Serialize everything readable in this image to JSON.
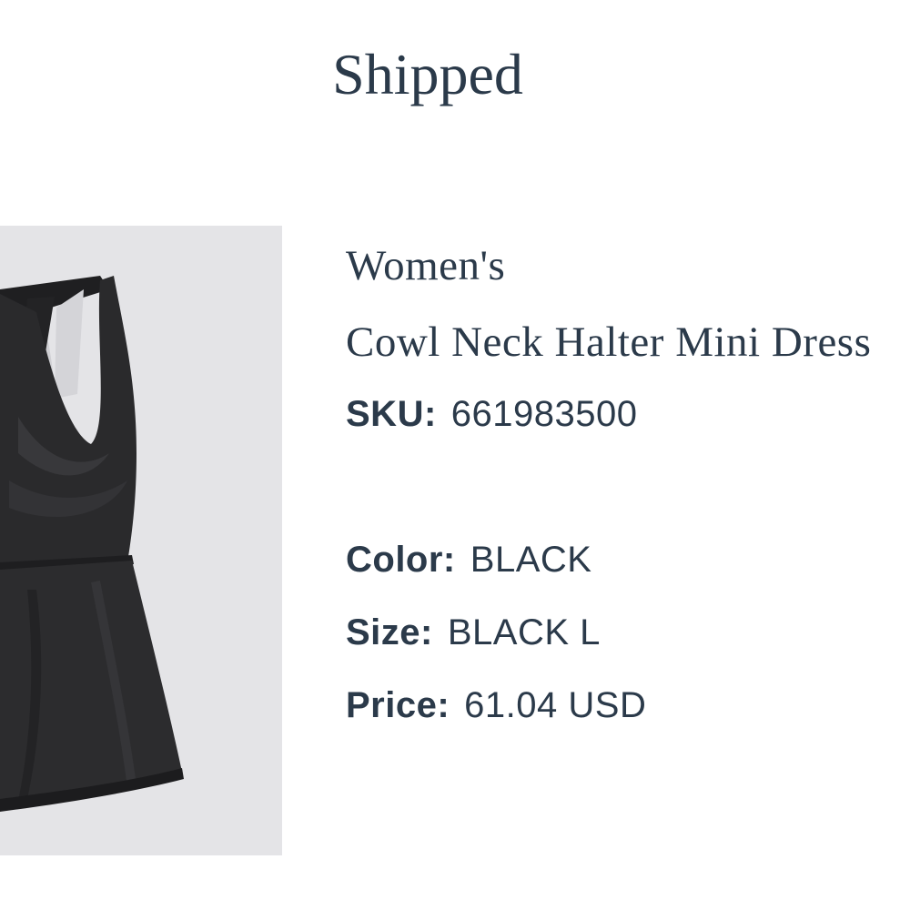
{
  "header": {
    "status": "Shipped"
  },
  "product": {
    "image_icon": "black-cowl-neck-halter-dress-image",
    "brand": "Women's",
    "name": "Cowl Neck Halter Mini Dress",
    "sku_label": "SKU:",
    "sku": "661983500",
    "color_label": "Color:",
    "color": "BLACK",
    "size_label": "Size:",
    "size": "BLACK L",
    "price_label": "Price:",
    "price": "61.04 USD"
  },
  "colors": {
    "text": "#2b3a4a",
    "image_background": "#e4e4e7",
    "garment": "#2a2a2c"
  }
}
